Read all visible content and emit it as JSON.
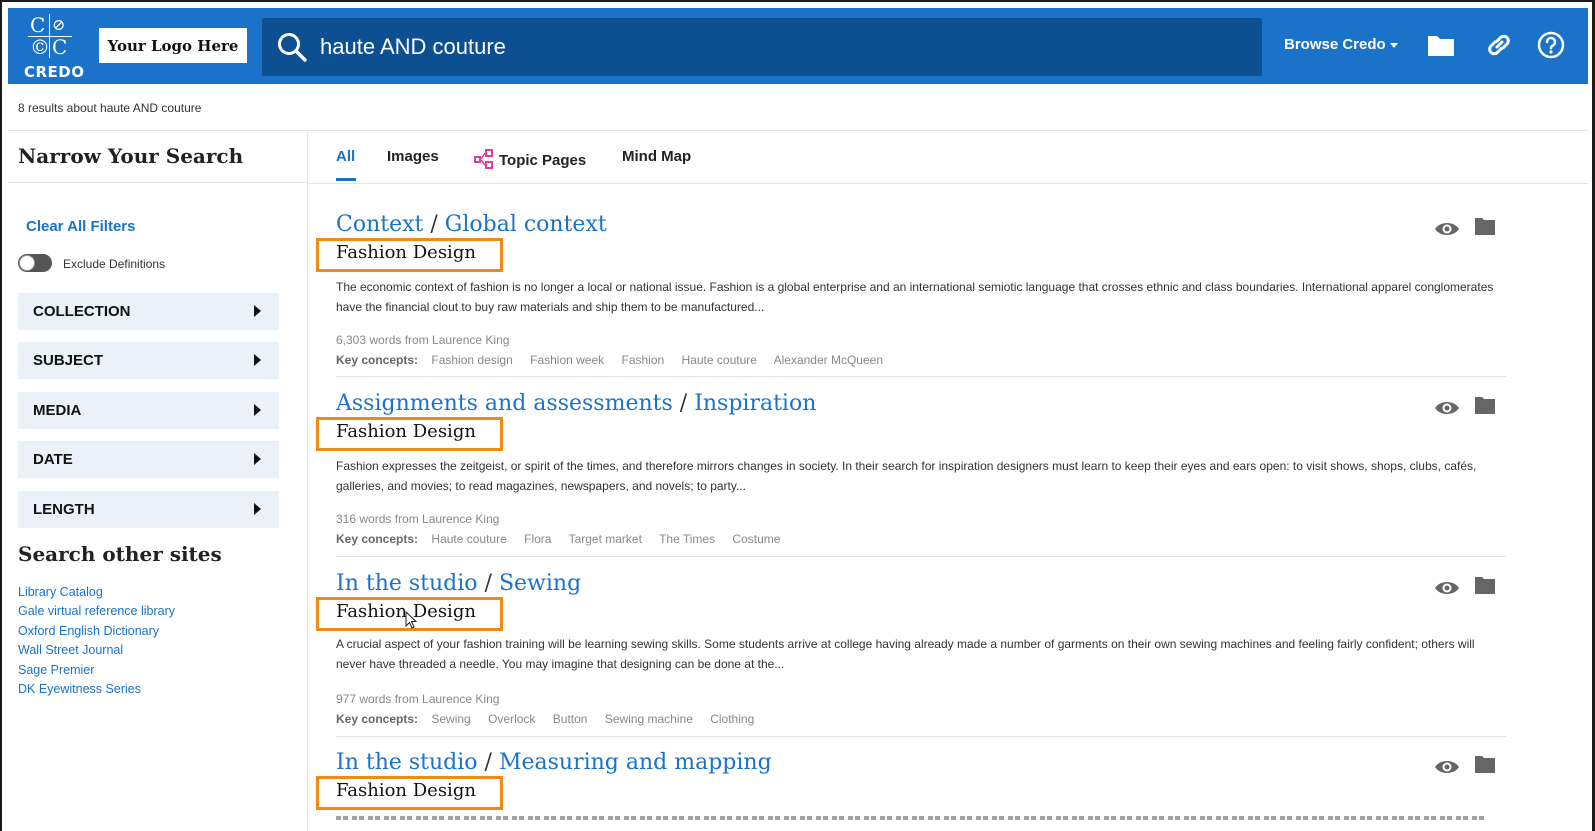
{
  "header": {
    "credo_letters": [
      "C",
      "⊘",
      "©",
      "C"
    ],
    "credo_word": "CREDO",
    "logo_placeholder": "Your Logo Here",
    "search_query": "haute AND couture",
    "browse_label": "Browse Credo",
    "icons": [
      "search-icon",
      "folder-icon",
      "link-icon",
      "help-icon"
    ],
    "accent_color": "#1a73c9",
    "search_bg_color": "#0d5091"
  },
  "result_count": "8 results about haute AND couture",
  "sidebar": {
    "title": "Narrow Your Search",
    "clear_filters": "Clear All Filters",
    "exclude_definitions": "Exclude Definitions",
    "facets": [
      "COLLECTION",
      "SUBJECT",
      "MEDIA",
      "DATE",
      "LENGTH"
    ],
    "other_sites_title": "Search other sites",
    "other_sites": [
      "Library Catalog",
      "Gale virtual reference library",
      "Oxford English Dictionary",
      "Wall Street Journal",
      "Sage Premier",
      "DK Eyewitness Series"
    ]
  },
  "tabs": [
    {
      "label": "All",
      "active": true
    },
    {
      "label": "Images",
      "active": false
    },
    {
      "label": "Topic Pages",
      "active": false
    },
    {
      "label": "Mind Map",
      "active": false
    }
  ],
  "results": [
    {
      "title_main": "Context",
      "title_sub": "Global context",
      "source_title": "Fashion Design",
      "snippet": "The economic context of fashion is no longer a local or national issue. Fashion is a global enterprise and an international semiotic language that crosses ethnic and class boundaries. International apparel conglomerates have the financial clout to buy raw materials and ship them to be manufactured...",
      "meta": "6,303 words from Laurence King",
      "concepts_label": "Key concepts:",
      "concepts": [
        "Fashion design",
        "Fashion week",
        "Fashion",
        "Haute couture",
        "Alexander McQueen"
      ]
    },
    {
      "title_main": "Assignments and assessments",
      "title_sub": "Inspiration",
      "source_title": "Fashion Design",
      "snippet": "Fashion expresses the zeitgeist, or spirit of the times, and therefore mirrors changes in society. In their search for inspiration designers must learn to keep their eyes and ears open: to visit shows, shops, clubs, cafés, galleries, and movies; to read magazines, newspapers, and novels; to party...",
      "meta": "316 words from Laurence King",
      "concepts_label": "Key concepts:",
      "concepts": [
        "Haute couture",
        "Flora",
        "Target market",
        "The Times",
        "Costume"
      ]
    },
    {
      "title_main": "In the studio",
      "title_sub": "Sewing",
      "source_title": "Fashion Design",
      "snippet": "A crucial aspect of your fashion training will be learning sewing skills. Some students arrive at college having already made a number of garments on their own sewing machines and feeling fairly confident; others will never have threaded a needle. You may imagine that designing can be done at the...",
      "meta": "977 words from Laurence King",
      "concepts_label": "Key concepts:",
      "concepts": [
        "Sewing",
        "Overlock",
        "Button",
        "Sewing machine",
        "Clothing"
      ]
    },
    {
      "title_main": "In the studio",
      "title_sub": "Measuring and mapping",
      "source_title": "Fashion Design",
      "snippet": "",
      "meta": "",
      "concepts_label": "",
      "concepts": []
    }
  ],
  "badge_color": "#ef8a17"
}
